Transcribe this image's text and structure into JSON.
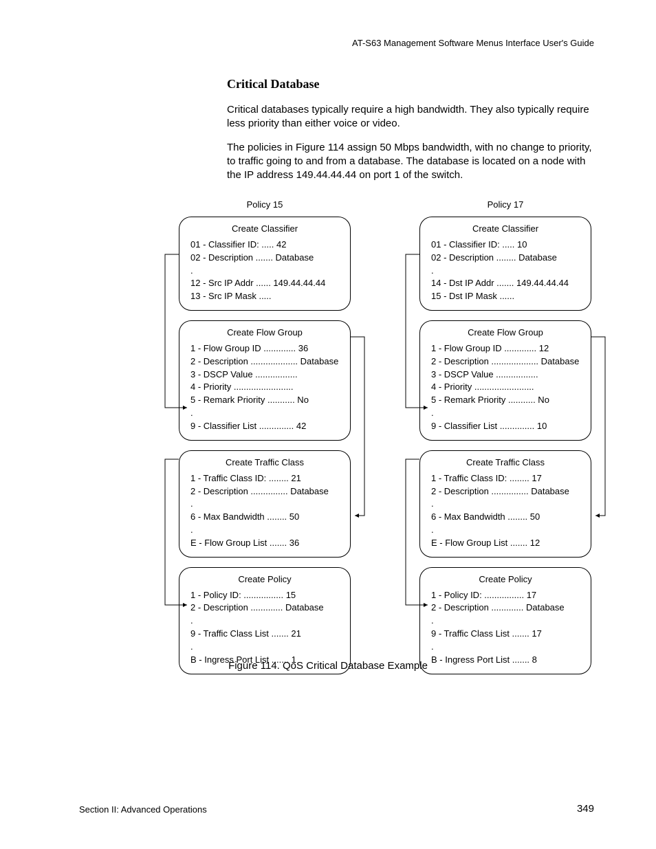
{
  "header": "AT-S63 Management Software Menus Interface User's Guide",
  "title": "Critical Database",
  "paragraphs": [
    "Critical databases typically require a high bandwidth. They also typically require less priority than either voice or video.",
    "The policies in Figure 114 assign 50 Mbps bandwidth, with no change to priority, to traffic going to and from a database. The database is located on a node with the IP address 149.44.44.44 on port 1 of the switch."
  ],
  "policies": {
    "left": {
      "label": "Policy 15",
      "classifier": {
        "title": "Create Classifier",
        "lines": [
          "01 - Classifier ID: ..... 42",
          "02 - Description ....... Database",
          ".",
          "12 - Src IP Addr ...... 149.44.44.44",
          "13 - Src IP Mask ....."
        ]
      },
      "flowgroup": {
        "title": "Create Flow Group",
        "lines": [
          "1 - Flow Group ID ............. 36",
          "2 - Description ................... Database",
          "3 - DSCP Value .................",
          "4 - Priority ........................",
          "5 - Remark Priority ........... No",
          ".",
          "9 - Classifier List .............. 42"
        ]
      },
      "traffic": {
        "title": "Create Traffic Class",
        "lines": [
          "1 - Traffic Class ID: ........ 21",
          "2 - Description ............... Database",
          ".",
          "6 - Max Bandwidth ........ 50",
          ".",
          "E - Flow Group List ....... 36"
        ]
      },
      "policy": {
        "title": "Create Policy",
        "lines": [
          "1 - Policy ID: ................ 15",
          "2 - Description ............. Database",
          ".",
          "9 - Traffic Class List ....... 21",
          ".",
          "B - Ingress Port List ....... 1"
        ]
      }
    },
    "right": {
      "label": "Policy 17",
      "classifier": {
        "title": "Create Classifier",
        "lines": [
          "01 - Classifier ID: ..... 10",
          "02 - Description ........ Database",
          ".",
          "14 - Dst IP Addr ....... 149.44.44.44",
          "15 - Dst IP Mask ......"
        ]
      },
      "flowgroup": {
        "title": "Create Flow Group",
        "lines": [
          "1 - Flow Group ID ............. 12",
          "2 - Description ................... Database",
          "3 - DSCP Value .................",
          "4 - Priority ........................",
          "5 - Remark Priority ........... No",
          ".",
          "9 - Classifier List .............. 10"
        ]
      },
      "traffic": {
        "title": "Create Traffic Class",
        "lines": [
          "1 - Traffic Class ID: ........ 17",
          "2 - Description ............... Database",
          ".",
          "6 - Max Bandwidth ........ 50",
          ".",
          "E - Flow Group List ....... 12"
        ]
      },
      "policy": {
        "title": "Create Policy",
        "lines": [
          "1 - Policy ID: ................ 17",
          "2 - Description ............. Database",
          ".",
          "9 - Traffic Class List ....... 17",
          ".",
          "B - Ingress Port List ....... 8"
        ]
      }
    }
  },
  "figure_caption": "Figure 114. QoS Critical Database Example",
  "footer_left": "Section II: Advanced Operations",
  "footer_right": "349"
}
